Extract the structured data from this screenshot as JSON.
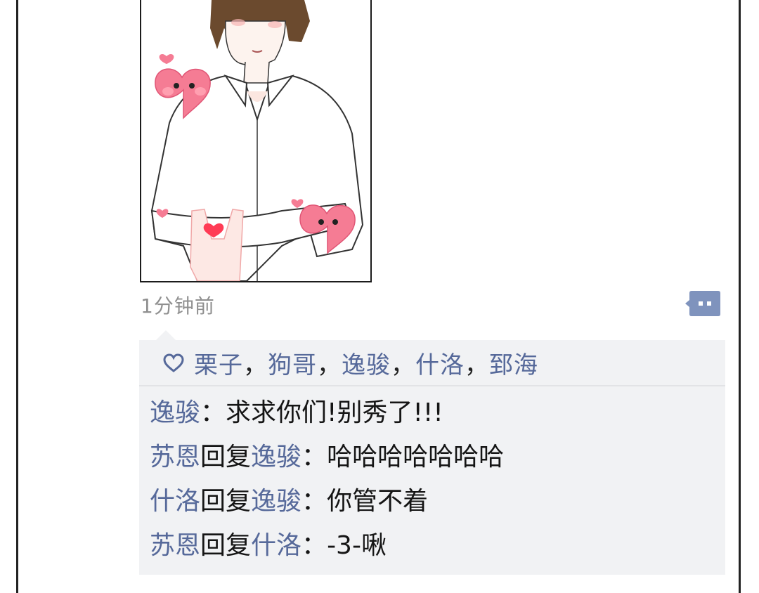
{
  "post": {
    "image_alt": "anime man in white shirt with pink hearts",
    "timestamp": "1分钟前",
    "comment_icon": "comment-bubble-icon"
  },
  "likes": {
    "icon": "heart-outline-icon",
    "names": [
      "栗子",
      "狗哥",
      "逸骏",
      "什洛",
      "郅海"
    ],
    "separator": "，"
  },
  "comments": [
    {
      "author": "逸骏",
      "reply_label": "",
      "reply_to": "",
      "colon": "：",
      "text": "求求你们!别秀了!!!"
    },
    {
      "author": "苏恩",
      "reply_label": "回复",
      "reply_to": "逸骏",
      "colon": "：",
      "text": "哈哈哈哈哈哈哈"
    },
    {
      "author": "什洛",
      "reply_label": "回复",
      "reply_to": "逸骏",
      "colon": "：",
      "text": "你管不着"
    },
    {
      "author": "苏恩",
      "reply_label": "回复",
      "reply_to": "什洛",
      "colon": "：",
      "text": "-3-啾"
    }
  ],
  "colors": {
    "name_link": "#56699a",
    "comment_bg": "#f1f2f4",
    "timestamp": "#8f8f8f",
    "heart_pink": "#f0607a"
  }
}
